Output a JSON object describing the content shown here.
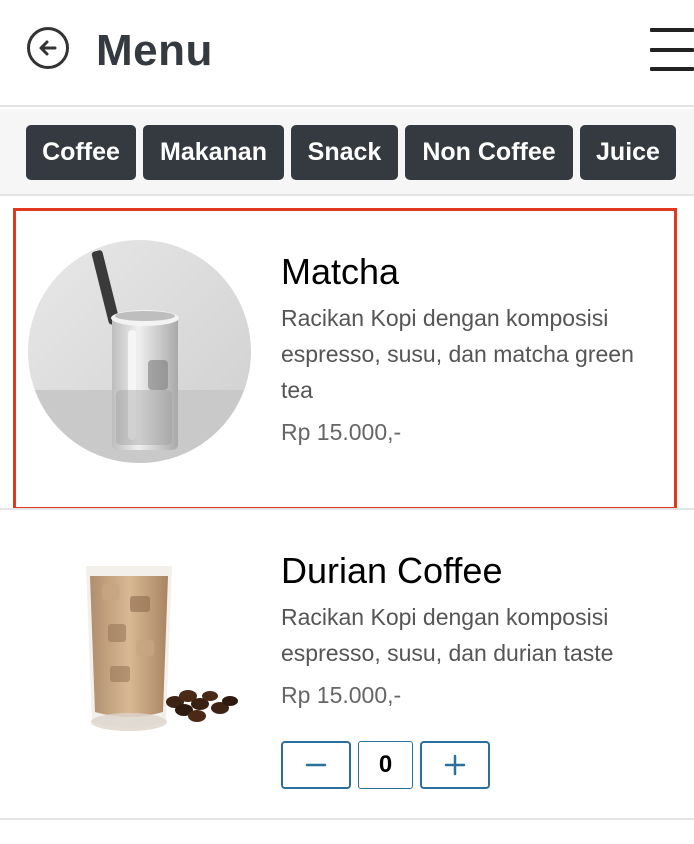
{
  "header": {
    "title": "Menu",
    "back_icon": "arrow-left-circle-icon",
    "menu_icon": "hamburger-icon"
  },
  "categories": [
    {
      "label": "Coffee"
    },
    {
      "label": "Makanan"
    },
    {
      "label": "Snack"
    },
    {
      "label": "Non Coffee"
    },
    {
      "label": "Juice"
    }
  ],
  "items": [
    {
      "name": "Matcha",
      "description": "Racikan Kopi dengan komposisi espresso, susu, dan matcha green tea",
      "price": "Rp 15.000,-",
      "image": "matcha-drink-image",
      "selected": true
    },
    {
      "name": "Durian Coffee",
      "description": "Racikan Kopi dengan komposisi espresso, susu, dan durian taste",
      "price": "Rp 15.000,-",
      "image": "durian-coffee-image",
      "quantity": "0"
    }
  ],
  "colors": {
    "accent_dark": "#343a40",
    "highlight_border": "#e0391f",
    "stepper_blue": "#2b6f9c"
  }
}
